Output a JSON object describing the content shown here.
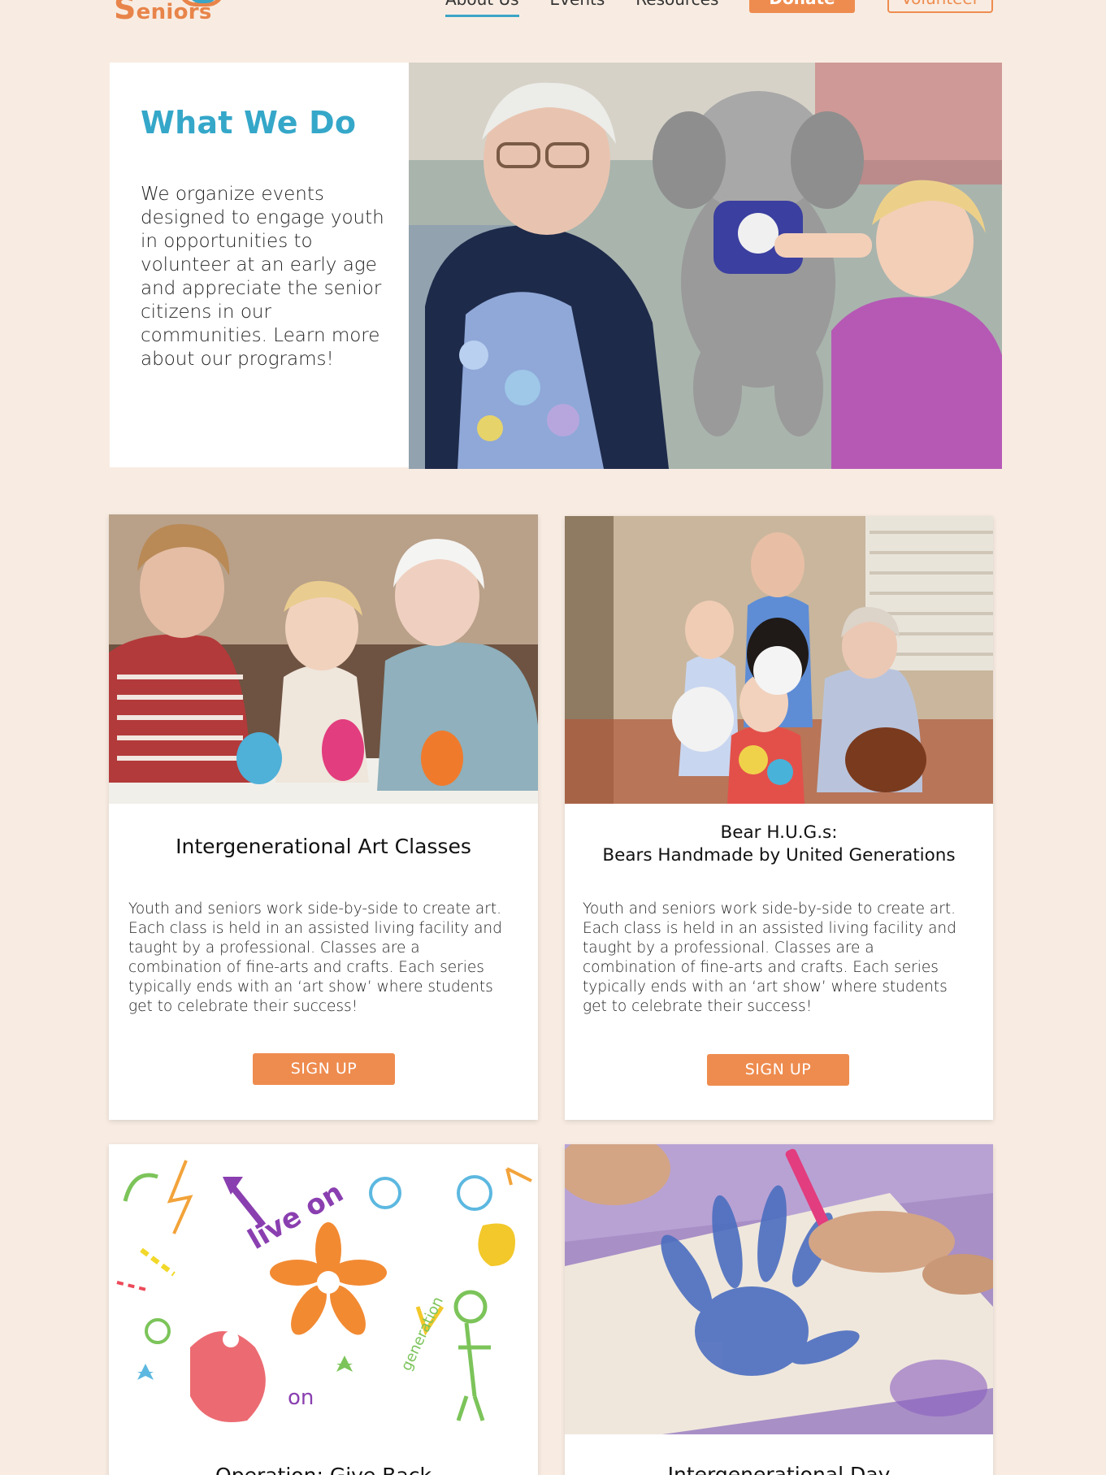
{
  "header": {
    "logo_text_initial": "S",
    "logo_text_rest": "eniors",
    "nav": [
      {
        "label": "About Us",
        "active": true
      },
      {
        "label": "Events",
        "active": false
      },
      {
        "label": "Resources",
        "active": false
      }
    ],
    "donate_label": "Donate",
    "volunteer_label": "Volunteer"
  },
  "hero": {
    "title": "What We Do",
    "body": "We organize events designed to engage youth in opportunities to volunteer at an early age and appreciate the senior citizens in our communities. Learn more about our programs!"
  },
  "programs": [
    {
      "title": "Intergenerational Art Classes",
      "title_line2": "",
      "description": "Youth and seniors work side-by-side to create art. Each class is held in an assisted living facility and taught by a professional. Classes are a combination of fine-arts and crafts. Each series typically ends with an ‘art show’ where students get to celebrate their success!",
      "button": "SIGN UP"
    },
    {
      "title": "Bear H.U.G.s:",
      "title_line2": "Bears Handmade by United Generations",
      "description": "Youth and seniors work side-by-side to create art. Each class is held in an assisted living facility and taught by a professional. Classes are a combination of fine-arts and crafts. Each series typically ends with an ‘art show’ where students get to celebrate their success!",
      "button": "SIGN UP"
    },
    {
      "title": "Operation: Give Back",
      "title_line2": "",
      "description": "",
      "button": ""
    },
    {
      "title": "Intergenerational Day",
      "title_line2": "",
      "description": "",
      "button": ""
    }
  ],
  "colors": {
    "background": "#f8ece2",
    "accent_orange": "#ee8c4f",
    "accent_blue": "#35a7c9"
  },
  "doodle_texts": [
    "live on",
    "generation",
    "on"
  ]
}
